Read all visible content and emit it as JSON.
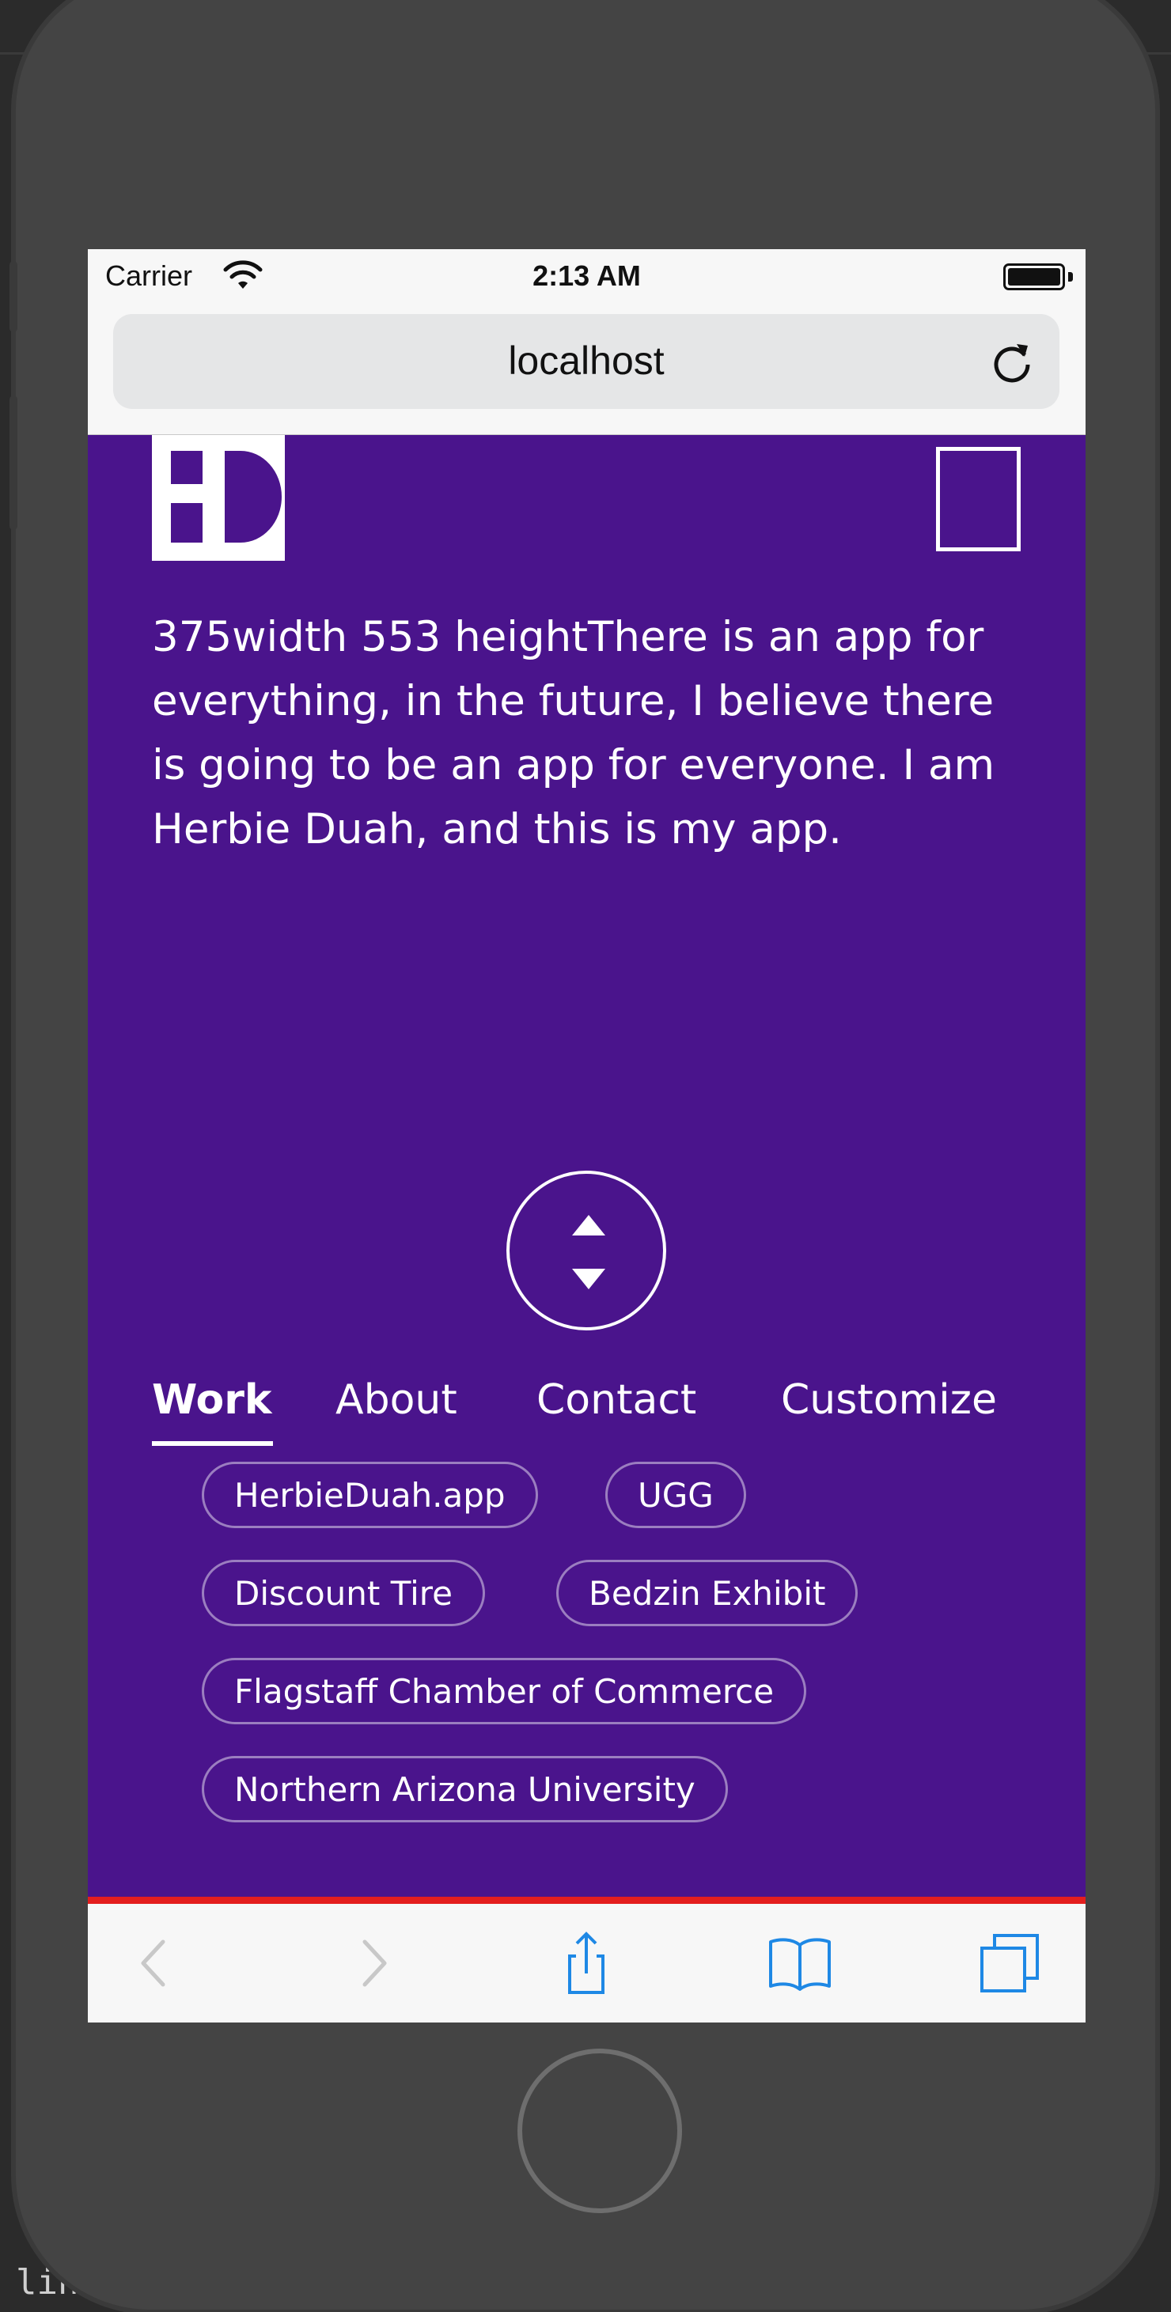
{
  "status_bar": {
    "carrier": "Carrier",
    "time": "2:13 AM"
  },
  "browser": {
    "address": "localhost"
  },
  "page": {
    "intro": "375width 553 heightThere is an app for everything, in the future, I believe there is going to be an app for everyone. I am Herbie Duah, and this is my app.",
    "tabs": [
      {
        "label": "Work",
        "active": true
      },
      {
        "label": "About",
        "active": false
      },
      {
        "label": "Contact",
        "active": false
      },
      {
        "label": "Customize",
        "active": false
      }
    ],
    "chips": [
      "HerbieDuah.app",
      "UGG",
      "Discount Tire",
      "Bedzin Exhibit",
      "Flagstaff Chamber of Commerce",
      "Northern Arizona University"
    ]
  },
  "background_editor": {
    "visible_text": "line before."
  },
  "colors": {
    "page_background": "#4a148c",
    "accent_line": "#e41e1e",
    "toolbar_icon": "#1e88e5"
  },
  "icons": [
    "wifi-icon",
    "battery-icon",
    "reload-icon",
    "logo-icon",
    "menu-icon",
    "scroll-arrows-icon",
    "back-icon",
    "forward-icon",
    "share-icon",
    "bookmarks-icon",
    "tabs-icon"
  ]
}
